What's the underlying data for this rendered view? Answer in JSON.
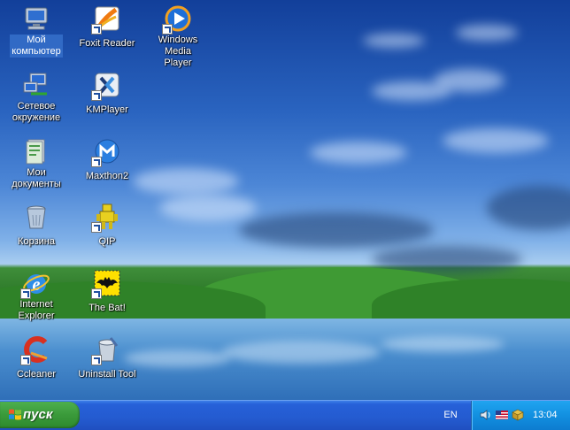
{
  "desktop": {
    "icons": [
      {
        "label": "Мой\nкомпьютер",
        "icon": "my-computer-icon"
      },
      {
        "label": "Сетевое\nокружение",
        "icon": "network-places-icon"
      },
      {
        "label": "Мои\nдокументы",
        "icon": "my-documents-icon"
      },
      {
        "label": "Корзина",
        "icon": "recycle-bin-icon"
      },
      {
        "label": "Internet\nExplorer",
        "icon": "internet-explorer-icon"
      },
      {
        "label": "Ccleaner",
        "icon": "ccleaner-icon"
      },
      {
        "label": "Foxit Reader",
        "icon": "foxit-reader-icon"
      },
      {
        "label": "KMPlayer",
        "icon": "kmplayer-icon"
      },
      {
        "label": "Maxthon2",
        "icon": "maxthon-icon"
      },
      {
        "label": "QIP",
        "icon": "qip-icon"
      },
      {
        "label": "The Bat!",
        "icon": "the-bat-icon"
      },
      {
        "label": "Uninstall Tool",
        "icon": "uninstall-tool-icon"
      },
      {
        "label": "Windows Media\nPlayer",
        "icon": "windows-media-player-icon"
      }
    ]
  },
  "taskbar": {
    "start_label": "пуск",
    "language": "EN",
    "tray_icons": [
      "volume-icon",
      "flag-icon",
      "network-icon"
    ],
    "clock": "13:04"
  },
  "colors": {
    "taskbar": "#245bd0",
    "start_button": "#3a9a3a",
    "tray": "#1290e0",
    "selection": "#316ac5"
  }
}
